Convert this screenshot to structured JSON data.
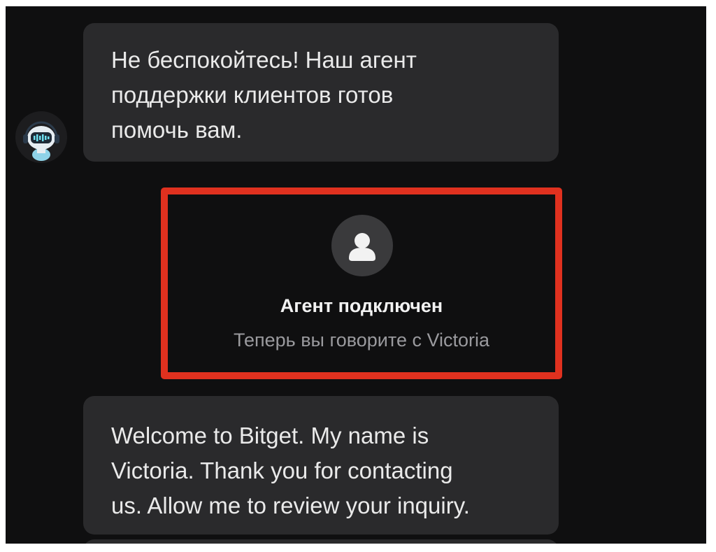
{
  "chat": {
    "messages": [
      {
        "sender": "bot",
        "lines": [
          "Не беспокойтесь! Наш агент",
          "поддержки клиентов готов",
          "помочь вам."
        ]
      },
      {
        "sender": "agent",
        "lines": [
          "Welcome to Bitget. My name is",
          "Victoria. Thank you for contacting",
          "us. Allow me to review your inquiry."
        ]
      }
    ],
    "system_notice": {
      "title": "Агент подключен",
      "subtitle": "Теперь вы говорите с Victoria"
    }
  },
  "icons": {
    "bot_avatar": "robot-headset-icon",
    "agent_avatar": "user-silhouette-icon"
  },
  "colors": {
    "background": "#0f0f10",
    "bubble": "#2a2a2c",
    "highlight": "#e0311f",
    "text": "#eaeaea",
    "muted_text": "#9a9a9e"
  }
}
